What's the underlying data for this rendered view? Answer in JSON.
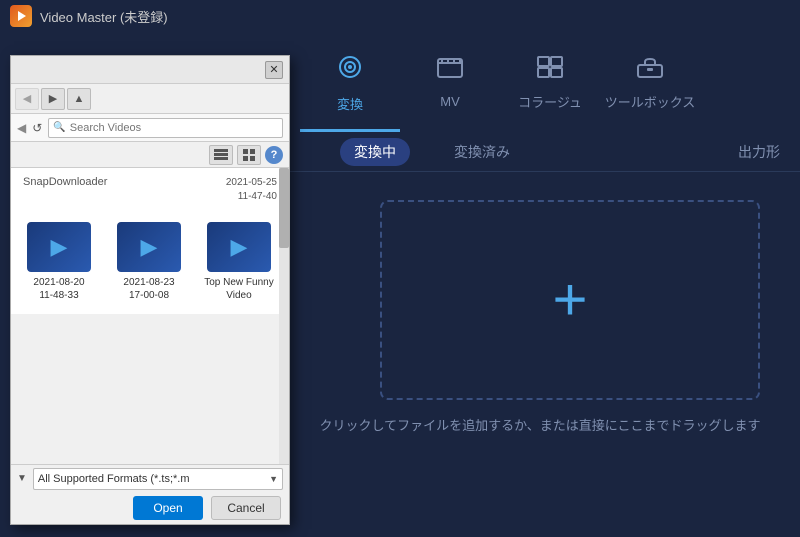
{
  "app": {
    "title": "Video Master (未登録)"
  },
  "nav": {
    "tabs": [
      {
        "id": "convert",
        "label": "変換",
        "icon": "⊙",
        "active": true
      },
      {
        "id": "mv",
        "label": "MV",
        "icon": "🖼"
      },
      {
        "id": "collage",
        "label": "コラージュ",
        "icon": "⊞"
      },
      {
        "id": "toolbox",
        "label": "ツールボックス",
        "icon": "🧰"
      }
    ]
  },
  "sub_tabs": {
    "items": [
      {
        "id": "converting",
        "label": "変換中",
        "active": true
      },
      {
        "id": "converted",
        "label": "変換済み",
        "active": false
      }
    ],
    "output_label": "出力形"
  },
  "drop_area": {
    "plus_symbol": "+",
    "hint_text": "クリックしてファイルを追加するか、または直接にここまでドラッグします"
  },
  "file_dialog": {
    "search_placeholder": "Search Videos",
    "breadcrumb": "SnapDownloader",
    "files": [
      {
        "name": "2021-08-20\n11-48-33",
        "date": "2021-08-20 11-48-33"
      },
      {
        "name": "2021-08-23\n17-00-08",
        "date": "2021-08-23 17-00-08"
      },
      {
        "name": "Top New Funny\nVideo",
        "date": ""
      }
    ],
    "format_label": "All Supported Formats (*.ts;*.m",
    "btn_open": "Open",
    "btn_cancel": "Cancel",
    "header_date": "2021-05-25\n11-47-40"
  }
}
